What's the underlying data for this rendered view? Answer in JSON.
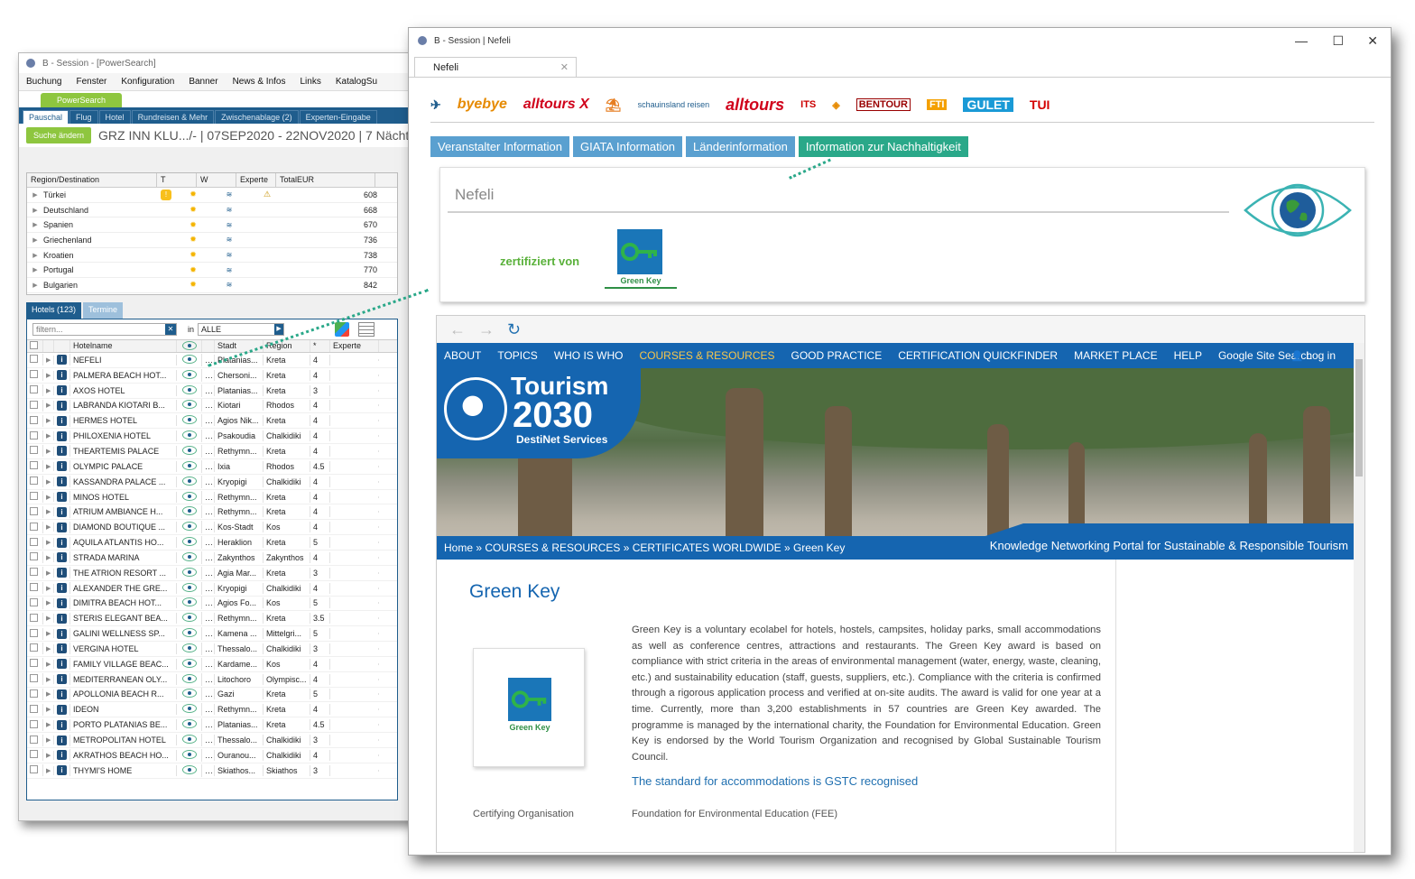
{
  "back_window": {
    "title": "B - Session - [PowerSearch]",
    "menu": [
      "Buchung",
      "Fenster",
      "Konfiguration",
      "Banner",
      "News & Infos",
      "Links",
      "KatalogSu"
    ],
    "powersearch_tab": "PowerSearch",
    "subtabs": [
      "Pauschal",
      "Flug",
      "Hotel",
      "Rundreisen & Mehr",
      "Zwischenablage (2)",
      "Experten-Eingabe"
    ],
    "search_button": "Suche ändern",
    "search_summary": "GRZ INN KLU.../- | 07SEP2020 - 22NOV2020 | 7 Nächt",
    "dest_headers": [
      "Region/Destination",
      "T",
      "W",
      "Experte",
      "TotalEUR"
    ],
    "destinations": [
      {
        "name": "Türkei",
        "warn": "!",
        "exp": "⚠",
        "total": "608"
      },
      {
        "name": "Deutschland",
        "warn": "",
        "exp": "",
        "total": "668"
      },
      {
        "name": "Spanien",
        "warn": "",
        "exp": "",
        "total": "670"
      },
      {
        "name": "Griechenland",
        "warn": "",
        "exp": "",
        "total": "736"
      },
      {
        "name": "Kroatien",
        "warn": "",
        "exp": "",
        "total": "738"
      },
      {
        "name": "Portugal",
        "warn": "",
        "exp": "",
        "total": "770"
      },
      {
        "name": "Bulgarien",
        "warn": "",
        "exp": "",
        "total": "842"
      }
    ],
    "lower_tabs": [
      "Hotels (123)",
      "Termine"
    ],
    "filter_placeholder": "filtern...",
    "in_label": "in",
    "in_value": "ALLE",
    "hotel_headers": [
      "Hotelname",
      "Stadt",
      "Region",
      "*",
      "Experte"
    ],
    "hotels": [
      {
        "name": "NEFELI",
        "city": "Platanias...",
        "region": "Kreta",
        "stars": "4"
      },
      {
        "name": "PALMERA BEACH HOT...",
        "city": "Chersoni...",
        "region": "Kreta",
        "stars": "4"
      },
      {
        "name": "AXOS HOTEL",
        "city": "Platanias...",
        "region": "Kreta",
        "stars": "3"
      },
      {
        "name": "LABRANDA KIOTARI B...",
        "city": "Kiotari",
        "region": "Rhodos",
        "stars": "4"
      },
      {
        "name": "HERMES HOTEL",
        "city": "Agios Nik...",
        "region": "Kreta",
        "stars": "4"
      },
      {
        "name": "PHILOXENIA HOTEL",
        "city": "Psakoudia",
        "region": "Chalkidiki",
        "stars": "4"
      },
      {
        "name": "THEARTEMIS PALACE",
        "city": "Rethymn...",
        "region": "Kreta",
        "stars": "4"
      },
      {
        "name": "OLYMPIC PALACE",
        "city": "Ixia",
        "region": "Rhodos",
        "stars": "4.5"
      },
      {
        "name": "KASSANDRA PALACE ...",
        "city": "Kryopigi",
        "region": "Chalkidiki",
        "stars": "4"
      },
      {
        "name": "MINOS HOTEL",
        "city": "Rethymn...",
        "region": "Kreta",
        "stars": "4"
      },
      {
        "name": "ATRIUM AMBIANCE H...",
        "city": "Rethymn...",
        "region": "Kreta",
        "stars": "4"
      },
      {
        "name": "DIAMOND BOUTIQUE ...",
        "city": "Kos-Stadt",
        "region": "Kos",
        "stars": "4"
      },
      {
        "name": "AQUILA ATLANTIS HO...",
        "city": "Heraklion",
        "region": "Kreta",
        "stars": "5"
      },
      {
        "name": "STRADA MARINA",
        "city": "Zakynthos",
        "region": "Zakynthos",
        "stars": "4"
      },
      {
        "name": "THE ATRION RESORT ...",
        "city": "Agia Mar...",
        "region": "Kreta",
        "stars": "3"
      },
      {
        "name": "ALEXANDER THE GRE...",
        "city": "Kryopigi",
        "region": "Chalkidiki",
        "stars": "4"
      },
      {
        "name": "DIMITRA BEACH HOT...",
        "city": "Agios Fo...",
        "region": "Kos",
        "stars": "5"
      },
      {
        "name": "STERIS ELEGANT BEA...",
        "city": "Rethymn...",
        "region": "Kreta",
        "stars": "3.5"
      },
      {
        "name": "GALINI WELLNESS SP...",
        "city": "Kamena ...",
        "region": "Mittelgri...",
        "stars": "5"
      },
      {
        "name": "VERGINA HOTEL",
        "city": "Thessalo...",
        "region": "Chalkidiki",
        "stars": "3"
      },
      {
        "name": "FAMILY VILLAGE BEAC...",
        "city": "Kardame...",
        "region": "Kos",
        "stars": "4"
      },
      {
        "name": "MEDITERRANEAN OLY...",
        "city": "Litochoro",
        "region": "Olympisc...",
        "stars": "4"
      },
      {
        "name": "APOLLONIA BEACH R...",
        "city": "Gazi",
        "region": "Kreta",
        "stars": "5"
      },
      {
        "name": "IDEON",
        "city": "Rethymn...",
        "region": "Kreta",
        "stars": "4"
      },
      {
        "name": "PORTO PLATANIAS BE...",
        "city": "Platanias...",
        "region": "Kreta",
        "stars": "4.5"
      },
      {
        "name": "METROPOLITAN HOTEL",
        "city": "Thessalo...",
        "region": "Chalkidiki",
        "stars": "3"
      },
      {
        "name": "AKRATHOS BEACH HO...",
        "city": "Ouranou...",
        "region": "Chalkidiki",
        "stars": "4"
      },
      {
        "name": "THYMI'S HOME",
        "city": "Skiathos...",
        "region": "Skiathos",
        "stars": "3"
      }
    ]
  },
  "front_window": {
    "title": "B - Session | Nefeli",
    "tab": "Nefeli",
    "logos": [
      "byebye",
      "alltours X",
      "schauinsland reisen",
      "alltours",
      "ITS",
      "BENTOUR",
      "FTI",
      "GULET",
      "TUI"
    ],
    "info_tabs": [
      "Veranstalter Information",
      "GIATA Information",
      "Länderinformation",
      "Information zur Nachhaltigkeit"
    ],
    "hotel_name": "Nefeli",
    "certified_by": "zertifiziert von",
    "green_key_label": "Green Key",
    "site_nav": [
      "ABOUT",
      "TOPICS",
      "WHO IS WHO",
      "COURSES & RESOURCES",
      "GOOD PRACTICE",
      "CERTIFICATION QUICKFINDER",
      "MARKET PLACE",
      "HELP",
      "Google Site Search"
    ],
    "login": "Log in",
    "hero_title_1": "Tourism",
    "hero_title_2": "2030",
    "hero_subtitle": "DestiNet Services",
    "breadcrumb": "Home » COURSES & RESOURCES » CERTIFICATES WORLDWIDE » Green Key",
    "portal_tag": "Knowledge Networking Portal for Sustainable & Responsible Tourism",
    "page_title": "Green Key",
    "description": "Green Key is a voluntary ecolabel for hotels, hostels, campsites, holiday parks, small accommodations as well as conference centres, attractions and restaurants. The Green Key award is based on compliance with strict criteria in the areas of environmental management (water, energy, waste, cleaning, etc.) and sustainability education (staff, guests, suppliers, etc.). Compliance with the criteria is confirmed through a rigorous application process and verified at on-site audits. The award is valid for one year at a time. Currently, more than 3,200 establishments in 57 countries are Green Key awarded. The programme is managed by the international charity, the Foundation for Environmental Education. Green Key is endorsed by the World Tourism Organization and recognised by Global Sustainable Tourism Council.",
    "gstc_link": "The standard for accommodations is GSTC recognised",
    "cert_org_label": "Certifying Organisation",
    "cert_org_value": "Foundation for Environmental Education (FEE)"
  },
  "colors": {
    "accent_blue": "#1565b0",
    "accent_green": "#2aa889",
    "powersearch_green": "#8ec63f"
  }
}
